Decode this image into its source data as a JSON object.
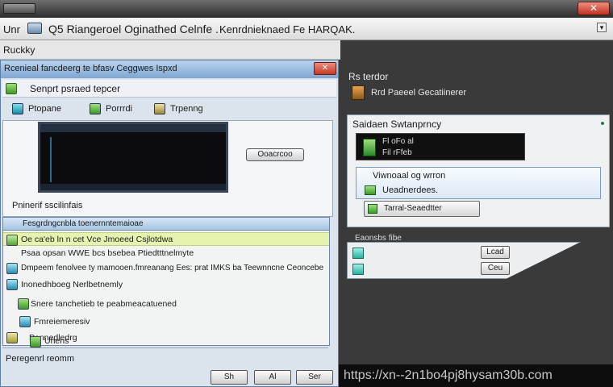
{
  "top": {
    "close_glyph": "✕"
  },
  "address": {
    "left_text": "Unr",
    "title_text": "Q5 Riangeroel Oginathed Celnfe .",
    "right_text": "Kenrdnieknaed Fe HARQAK.",
    "chevron": "▾"
  },
  "menu": {
    "label": "Ruckky"
  },
  "dialog": {
    "title": "Rcenieal fancdeerg te bfasv Ceggwes Ispxd",
    "close_glyph": "✕",
    "subtitle": "Senprt psraed tepcer",
    "tabs": [
      {
        "label": "Ptopane"
      },
      {
        "label": "Porrrdi"
      },
      {
        "label": "Trpenng"
      }
    ],
    "side_button": "Ooacrcoo",
    "status_label": "Pninerif sscilinfais",
    "list_header": "Fesgrdngcnbla toenernntemaioae",
    "rows": [
      {
        "text": "Oe ca'eb ln n cet Vce Jmoeed Csjlotdwa"
      },
      {
        "text": "Psaa opsan WWE bcs bsebea Ptiedtttnelmyte"
      },
      {
        "text": "Dmpeem fenolvee ty mamooen.fmreanang Ees: prat IMKS ba Teewnncne Ceoncebe"
      },
      {
        "text": "Inonedhboeg Nerlbetnemly"
      },
      {
        "text": "Snere tanchetieb te peabmeacatuened"
      },
      {
        "text": "Fmreiemeresiv"
      },
      {
        "text": "Pannedledrg"
      },
      {
        "text": "Uhens"
      }
    ],
    "bottom_label": "Peregenrl reomm",
    "buttons": [
      "Sh",
      "Al",
      "Ser"
    ]
  },
  "right": {
    "title": "Rs terdor",
    "row_label": "Rrd Paeeel Gecatiinerer",
    "panel": {
      "header": "Saidaen Swtanprncy",
      "dark_lines": [
        "Fl oFo al",
        "Fil rFfeb"
      ],
      "sel_line1": "Viwnoaal og wrron",
      "sel_line2": "Ueadnerdees.",
      "button": "Tarral-Seaedtter"
    },
    "second_title": "Eaonsbs fibe",
    "second_buttons": [
      "Lcad",
      "Ceu"
    ]
  },
  "watermark": "https://xn--2n1bo4pj8hysam30b.com",
  "colors": {
    "accent_blue": "#7fa7d2",
    "highlight_row": "#e6f3b0",
    "close_red": "#c23a26",
    "icon_green": "#3d9a2a"
  }
}
